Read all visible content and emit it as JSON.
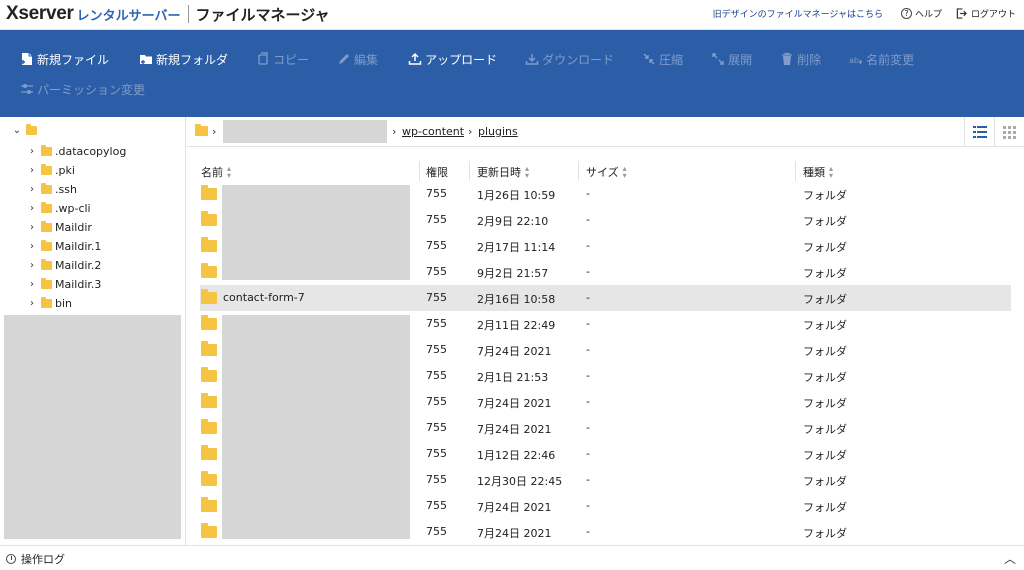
{
  "header": {
    "logo_main": "Xserver",
    "logo_sub": "レンタルサーバー",
    "app_title": "ファイルマネージャ",
    "old_design_link": "旧デザインのファイルマネージャはこちら",
    "help_label": "ヘルプ",
    "logout_label": "ログアウト"
  },
  "toolbar": {
    "new_file": "新規ファイル",
    "new_folder": "新規フォルダ",
    "copy": "コピー",
    "edit": "編集",
    "upload": "アップロード",
    "download": "ダウンロード",
    "compress": "圧縮",
    "extract": "展開",
    "delete": "削除",
    "rename": "名前変更",
    "permission": "パーミッション変更"
  },
  "sidebar": {
    "items": [
      {
        "label": ".datacopylog"
      },
      {
        "label": ".pki"
      },
      {
        "label": ".ssh"
      },
      {
        "label": ".wp-cli"
      },
      {
        "label": "Maildir"
      },
      {
        "label": "Maildir.1"
      },
      {
        "label": "Maildir.2"
      },
      {
        "label": "Maildir.3"
      },
      {
        "label": "bin"
      }
    ]
  },
  "breadcrumb": {
    "items": [
      "wp-content",
      "plugins"
    ]
  },
  "table": {
    "headers": {
      "name": "名前",
      "perm": "権限",
      "mtime": "更新日時",
      "size": "サイズ",
      "type": "種類"
    },
    "rows": [
      {
        "name": "",
        "perm": "755",
        "mtime": "1月26日 10:59",
        "size": "-",
        "type": "フォルダ"
      },
      {
        "name": "",
        "perm": "755",
        "mtime": "2月9日 22:10",
        "size": "-",
        "type": "フォルダ"
      },
      {
        "name": "",
        "perm": "755",
        "mtime": "2月17日 11:14",
        "size": "-",
        "type": "フォルダ"
      },
      {
        "name": "",
        "perm": "755",
        "mtime": "9月2日 21:57",
        "size": "-",
        "type": "フォルダ"
      },
      {
        "name": "contact-form-7",
        "perm": "755",
        "mtime": "2月16日 10:58",
        "size": "-",
        "type": "フォルダ"
      },
      {
        "name": "",
        "perm": "755",
        "mtime": "2月11日 22:49",
        "size": "-",
        "type": "フォルダ"
      },
      {
        "name": "",
        "perm": "755",
        "mtime": "7月24日 2021",
        "size": "-",
        "type": "フォルダ"
      },
      {
        "name": "",
        "perm": "755",
        "mtime": "2月1日 21:53",
        "size": "-",
        "type": "フォルダ"
      },
      {
        "name": "",
        "perm": "755",
        "mtime": "7月24日 2021",
        "size": "-",
        "type": "フォルダ"
      },
      {
        "name": "",
        "perm": "755",
        "mtime": "7月24日 2021",
        "size": "-",
        "type": "フォルダ"
      },
      {
        "name": "",
        "perm": "755",
        "mtime": "1月12日 22:46",
        "size": "-",
        "type": "フォルダ"
      },
      {
        "name": "",
        "perm": "755",
        "mtime": "12月30日 22:45",
        "size": "-",
        "type": "フォルダ"
      },
      {
        "name": "",
        "perm": "755",
        "mtime": "7月24日 2021",
        "size": "-",
        "type": "フォルダ"
      },
      {
        "name": "",
        "perm": "755",
        "mtime": "7月24日 2021",
        "size": "-",
        "type": "フォルダ"
      }
    ]
  },
  "footer": {
    "log_label": "操作ログ"
  }
}
